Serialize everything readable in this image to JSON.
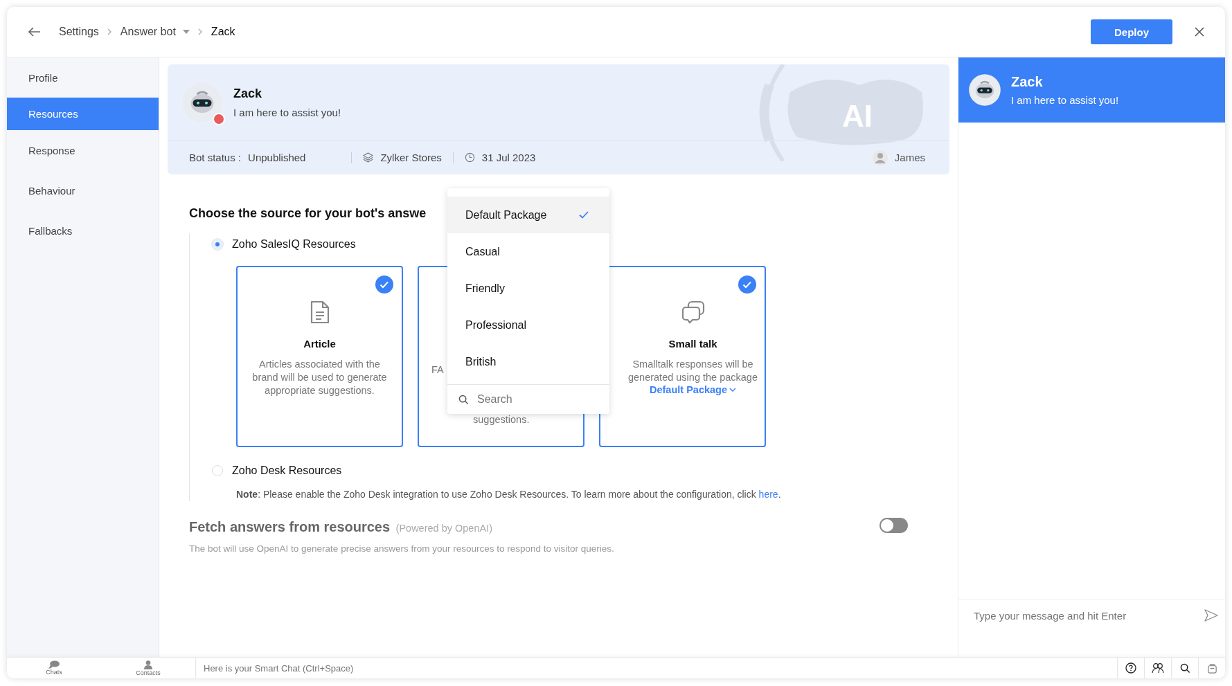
{
  "breadcrumb": [
    {
      "label": "Settings",
      "dropdown": false,
      "current": false
    },
    {
      "label": "Answer bot",
      "dropdown": true,
      "current": false
    },
    {
      "label": "Zack",
      "dropdown": false,
      "current": true
    }
  ],
  "deploy_button": "Deploy",
  "sidebar": {
    "items": [
      {
        "label": "Profile",
        "selected": false
      },
      {
        "label": "Resources",
        "selected": true
      },
      {
        "label": "Response",
        "selected": false
      },
      {
        "label": "Behaviour",
        "selected": false
      },
      {
        "label": "Fallbacks",
        "selected": false
      }
    ]
  },
  "bot": {
    "name": "Zack",
    "tagline": "I am here to assist you!",
    "status_label": "Bot status :",
    "status": "Unpublished",
    "brand": "Zylker Stores",
    "date": "31 Jul 2023",
    "owner": "James",
    "art_text": "AI"
  },
  "source_heading": "Choose the source for your bot's answe",
  "sources": [
    {
      "label": "Zoho SalesIQ Resources",
      "selected": true
    },
    {
      "label": "Zoho Desk Resources",
      "selected": false
    }
  ],
  "cards": [
    {
      "kind": "article",
      "title": "Article",
      "description": "Articles associated with the brand will be used to generate appropriate suggestions.",
      "checked": true
    },
    {
      "kind": "hidden",
      "visible_text": [
        "FA",
        "suggestions."
      ]
    },
    {
      "kind": "smalltalk",
      "title": "Small talk",
      "description": "Smalltalk responses will be generated using the package",
      "package": "Default Package",
      "checked": true
    }
  ],
  "note": {
    "text": "**Note**: Please enable the Zoho Desk integration to use Zoho Desk Resources. To learn more about the configuration, click ",
    "link": "here",
    "end": "."
  },
  "dropdown": {
    "options": [
      {
        "label": "Default Package",
        "selected": true
      },
      {
        "label": "Casual",
        "selected": false
      },
      {
        "label": "Friendly",
        "selected": false
      },
      {
        "label": "Professional",
        "selected": false
      },
      {
        "label": "British",
        "selected": false
      }
    ],
    "search_placeholder": "Search"
  },
  "fetch": {
    "title": "Fetch answers from resources",
    "powered": "(Powered by OpenAI)",
    "description": "The bot will use OpenAI to generate precise answers from your resources to respond to visitor queries.",
    "on": false
  },
  "preview": {
    "name": "Zack",
    "tagline": "I am here to assist you!",
    "input_placeholder": "Type your message and hit Enter"
  },
  "bottom_bar": {
    "tabs": [
      {
        "label": "Chats",
        "kind": "chats"
      },
      {
        "label": "Contacts",
        "kind": "contacts"
      }
    ],
    "smart_chat_placeholder": "Here is your Smart Chat (Ctrl+Space)"
  }
}
